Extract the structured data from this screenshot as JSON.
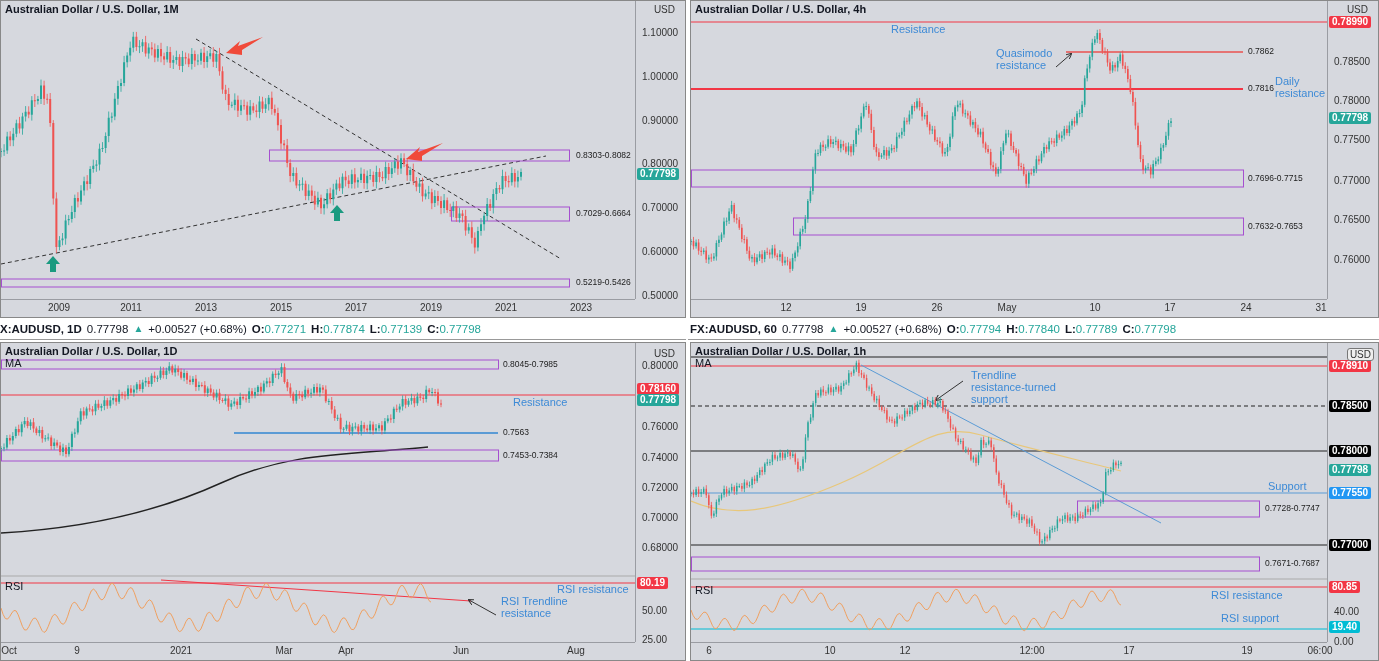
{
  "panels": [
    {
      "title": "Australian Dollar / U.S. Dollar, 1M",
      "currency": "USD",
      "price_ticks": [
        "1.10000",
        "1.00000",
        "0.90000",
        "0.80000",
        "0.70000",
        "0.60000",
        "0.50000"
      ],
      "time_ticks": [
        "2009",
        "2011",
        "2013",
        "2015",
        "2017",
        "2019",
        "2021",
        "2023"
      ],
      "price_tags": [
        {
          "text": "0.77798",
          "color": "#26a69a"
        }
      ],
      "zones": [
        {
          "label": "0.8303-0.8082"
        },
        {
          "label": "0.7029-0.6664"
        },
        {
          "label": "0.5219-0.5426"
        }
      ]
    },
    {
      "title": "Australian Dollar / U.S. Dollar, 4h",
      "currency": "USD",
      "price_ticks": [
        "0.78500",
        "0.78000",
        "0.77500",
        "0.77000",
        "0.76500",
        "0.76000"
      ],
      "time_ticks": [
        "12",
        "19",
        "26",
        "May",
        "10",
        "17",
        "24",
        "31"
      ],
      "price_tags": [
        {
          "text": "0.78990",
          "color": "#f23645"
        },
        {
          "text": "0.77798",
          "color": "#26a69a"
        }
      ],
      "zones": [
        {
          "label": "0.7696-0.7715"
        },
        {
          "label": "0.7632-0.7653"
        }
      ],
      "levels": [
        {
          "label": "0.7862",
          "color": "#e57373"
        },
        {
          "label": "0.7816",
          "color": "#f23645"
        }
      ],
      "annotations": [
        {
          "text": "Resistance"
        },
        {
          "text": "Quasimodo resistance"
        },
        {
          "text": "Daily resistance"
        }
      ]
    },
    {
      "legend": {
        "symbol": "X:AUDUSD, 1D",
        "price": "0.77798",
        "direction": "▲",
        "change": "+0.00527 (+0.68%)",
        "values": [
          {
            "key": "O:",
            "value": "0.77271"
          },
          {
            "key": "H:",
            "value": "0.77874"
          },
          {
            "key": "L:",
            "value": "0.77139"
          },
          {
            "key": "C:",
            "value": "0.77798"
          }
        ]
      },
      "title": "Australian Dollar / U.S. Dollar, 1D",
      "indicator": "MA",
      "currency": "USD",
      "price_ticks": [
        "0.80000",
        "0.76000",
        "0.74000",
        "0.72000",
        "0.70000",
        "0.68000"
      ],
      "time_ticks": [
        "Oct",
        "9",
        "2021",
        "Mar",
        "Apr",
        "Jun",
        "Aug"
      ],
      "price_tags": [
        {
          "text": "0.78160",
          "color": "#f23645"
        },
        {
          "text": "0.77798",
          "color": "#26a69a"
        }
      ],
      "zones": [
        {
          "label": "0.8045-0.7985"
        },
        {
          "label": "0.7453-0.7384"
        }
      ],
      "levels": [
        {
          "label": "0.7563",
          "color": "#5b9bd5"
        }
      ],
      "annotations": [
        {
          "text": "Resistance"
        },
        {
          "text": "RSI resistance"
        },
        {
          "text": "RSI Trendline resistance"
        }
      ],
      "rsi": {
        "label": "RSI",
        "ticks": [
          "50.00",
          "25.00"
        ],
        "tags": [
          {
            "text": "80.19",
            "color": "#f23645"
          }
        ]
      }
    },
    {
      "legend": {
        "symbol": "FX:AUDUSD, 60",
        "price": "0.77798",
        "direction": "▲",
        "change": "+0.00527 (+0.68%)",
        "values": [
          {
            "key": "O:",
            "value": "0.77794"
          },
          {
            "key": "H:",
            "value": "0.77840"
          },
          {
            "key": "L:",
            "value": "0.77789"
          },
          {
            "key": "C:",
            "value": "0.77798"
          }
        ]
      },
      "title": "Australian Dollar / U.S. Dollar, 1h",
      "indicator": "MA",
      "currency": "USD",
      "time_ticks": [
        "6",
        "10",
        "12",
        "12:00",
        "17",
        "19",
        "06:00"
      ],
      "price_tags": [
        {
          "text": "0.78910",
          "color": "#f23645"
        },
        {
          "text": "0.78500",
          "color": "#000000"
        },
        {
          "text": "0.78000",
          "color": "#000000"
        },
        {
          "text": "0.77798",
          "color": "#26a69a"
        },
        {
          "text": "0.77550",
          "color": "#2196f3"
        },
        {
          "text": "0.77000",
          "color": "#000000"
        }
      ],
      "zones": [
        {
          "label": "0.7728-0.7747"
        },
        {
          "label": "0.7671-0.7687"
        }
      ],
      "annotations": [
        {
          "text": "Trendline resistance-turned support"
        },
        {
          "text": "Support"
        },
        {
          "text": "RSI resistance"
        },
        {
          "text": "RSI support"
        }
      ],
      "rsi": {
        "label": "RSI",
        "ticks": [
          "40.00",
          "0.00"
        ],
        "tags": [
          {
            "text": "80.85",
            "color": "#f23645"
          },
          {
            "text": "19.40",
            "color": "#00bcd4"
          }
        ]
      }
    }
  ]
}
